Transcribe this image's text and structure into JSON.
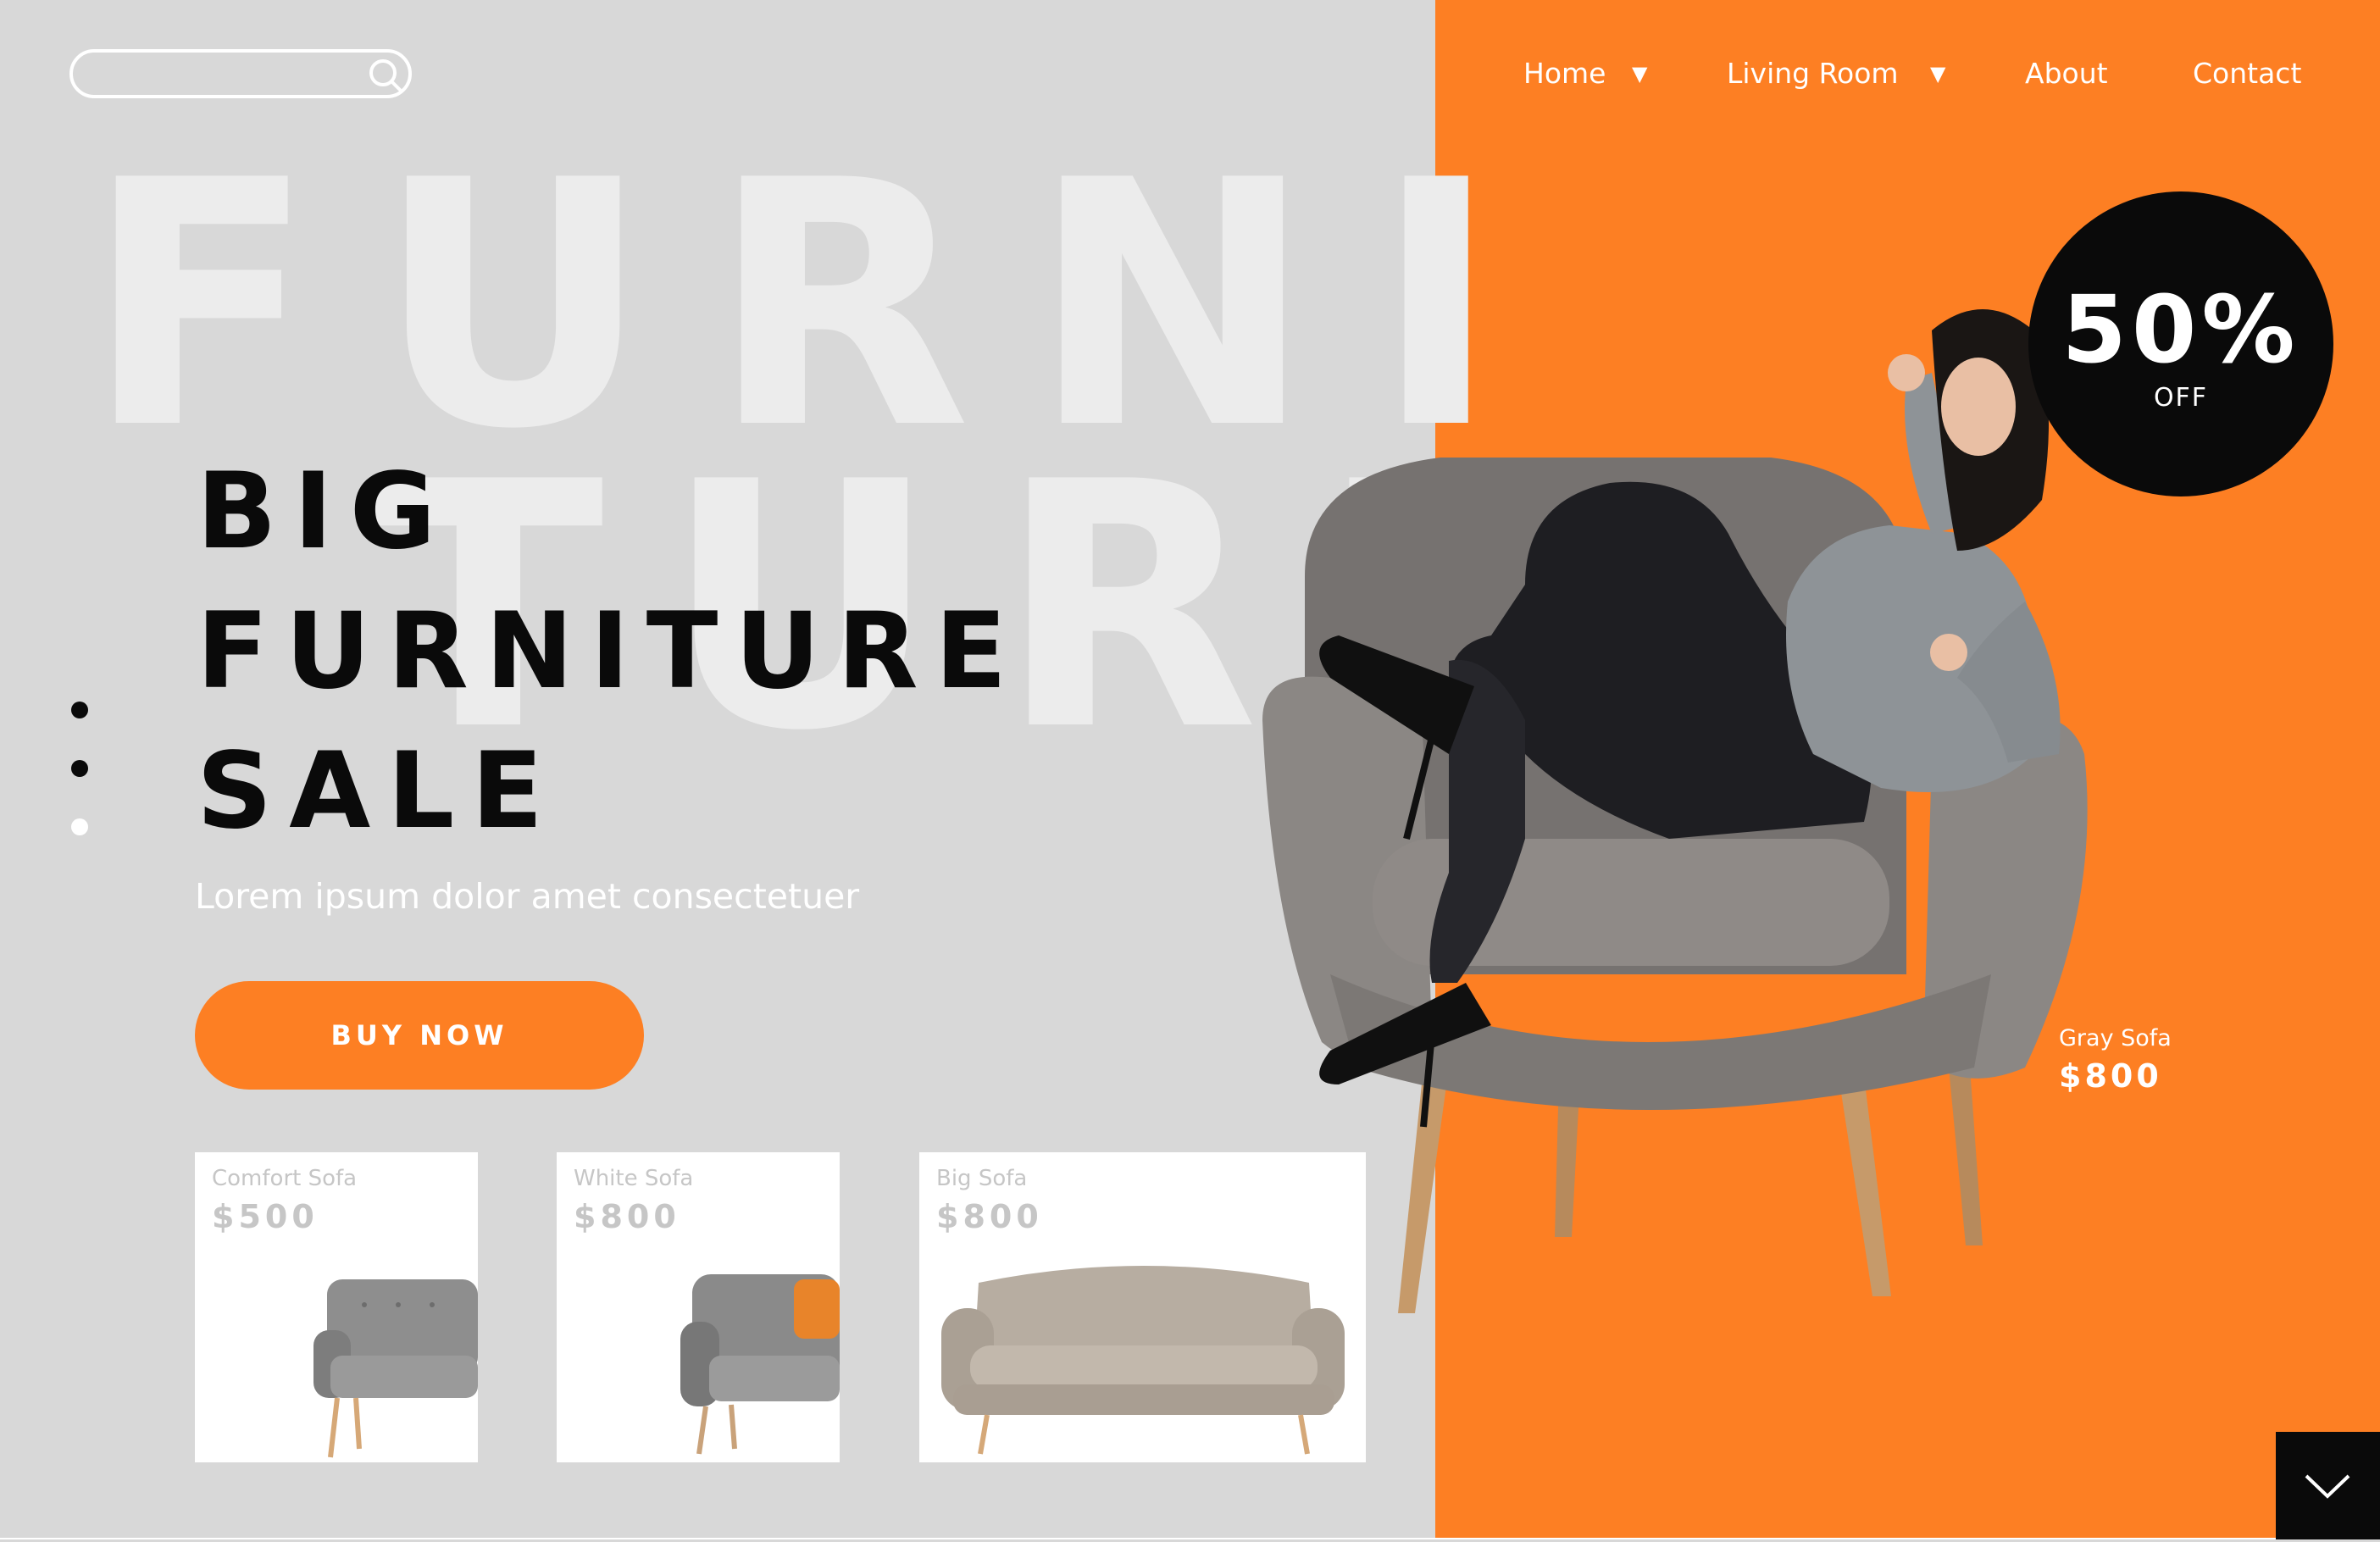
{
  "search": {
    "placeholder": ""
  },
  "nav": {
    "items": [
      {
        "label": "Home",
        "has_dropdown": true
      },
      {
        "label": "Living Room",
        "has_dropdown": true
      },
      {
        "label": "About",
        "has_dropdown": false
      },
      {
        "label": "Contact",
        "has_dropdown": false
      }
    ]
  },
  "hero": {
    "background_word_line1": "FURNI",
    "background_word_line2": "TURE",
    "headline": [
      "BIG",
      "FURNITURE",
      "SALE"
    ],
    "subtitle": "Lorem ipsum dolor amet consectetuer",
    "cta_label": "BUY NOW",
    "slide_dots": {
      "count": 3,
      "active_index": 2
    }
  },
  "discount": {
    "value": "50%",
    "label": "OFF"
  },
  "featured": {
    "name": "Gray Sofa",
    "price": "$800"
  },
  "products": [
    {
      "name": "Comfort Sofa",
      "price": "$500",
      "icon": "gray-loveseat"
    },
    {
      "name": "White Sofa",
      "price": "$800",
      "icon": "armchair-orange-pillow"
    },
    {
      "name": "Big Sofa",
      "price": "$800",
      "icon": "beige-sofa"
    }
  ],
  "scroll_button": {
    "icon": "chevron-down-icon"
  },
  "colors": {
    "accent": "#fd7f23",
    "left_background": "#d8d8d8",
    "dark": "#0a0a0a",
    "background_word": "#ececec",
    "card_text": "#c6c6c6"
  }
}
